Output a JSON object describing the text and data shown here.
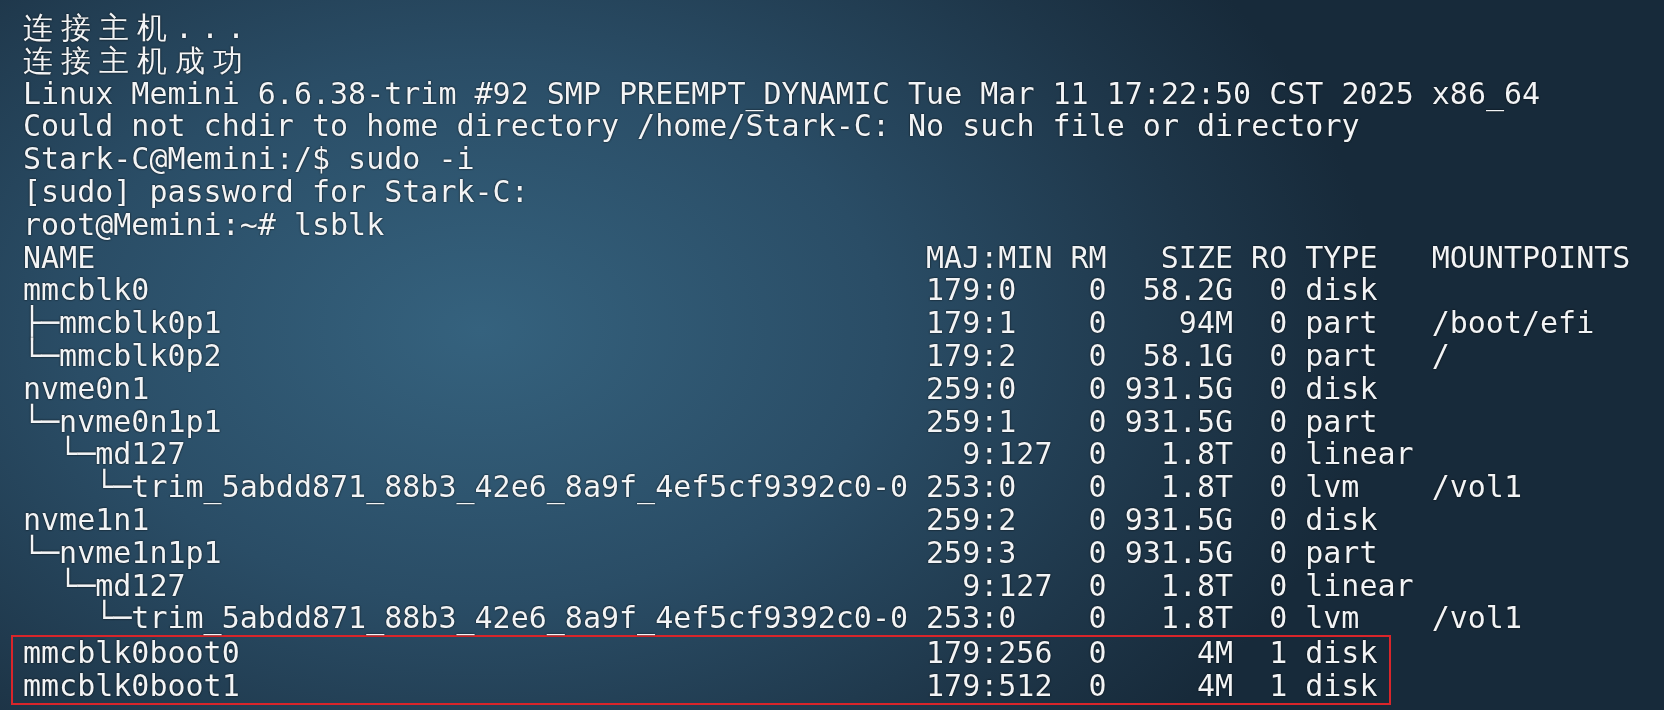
{
  "terminal": {
    "lines": [
      "连接主机...",
      "连接主机成功",
      "Linux Memini 6.6.38-trim #92 SMP PREEMPT_DYNAMIC Tue Mar 11 17:22:50 CST 2025 x86_64",
      "Could not chdir to home directory /home/Stark-C: No such file or directory",
      "Stark-C@Memini:/$ sudo -i",
      "[sudo] password for Stark-C:",
      "root@Memini:~# lsblk"
    ]
  },
  "lsblk": {
    "columns": [
      "NAME",
      "MAJ:MIN",
      "RM",
      "SIZE",
      "RO",
      "TYPE",
      "MOUNTPOINTS"
    ],
    "rows": [
      {
        "name": "mmcblk0",
        "maj_min": "179:0",
        "rm": "0",
        "size": "58.2G",
        "ro": "0",
        "type": "disk",
        "highlighted": false,
        "children": [
          {
            "name": "├─mmcblk0p1",
            "maj_min": "179:1",
            "rm": "0",
            "size": "94M",
            "ro": "0",
            "type": "part",
            "mountpoints": "/boot/efi"
          },
          {
            "name": "└─mmcblk0p2",
            "maj_min": "179:2",
            "rm": "0",
            "size": "58.1G",
            "ro": "0",
            "type": "part",
            "mountpoints": "/"
          }
        ]
      },
      {
        "name": "nvme0n1",
        "maj_min": "259:0",
        "rm": "0",
        "size": "931.5G",
        "ro": "0",
        "type": "disk",
        "highlighted": false,
        "children": [
          {
            "name": "└─nvme0n1p1",
            "maj_min": "259:1",
            "rm": "0",
            "size": "931.5G",
            "ro": "0",
            "type": "part",
            "children": [
              {
                "name": "└─md127",
                "maj_min": "  9:127",
                "rm": "0",
                "size": "1.8T",
                "ro": "0",
                "type": "linear",
                "children": [
                  {
                    "name": "└─trim_5abdd871_88b3_42e6_8a9f_4ef5cf9392c0-0",
                    "maj_min": "253:0",
                    "rm": "0",
                    "size": "1.8T",
                    "ro": "0",
                    "type": "lvm",
                    "mountpoints": "/vol1"
                  }
                ]
              }
            ]
          }
        ]
      },
      {
        "name": "nvme1n1",
        "maj_min": "259:2",
        "rm": "0",
        "size": "931.5G",
        "ro": "0",
        "type": "disk",
        "highlighted": false,
        "children": [
          {
            "name": "└─nvme1n1p1",
            "maj_min": "259:3",
            "rm": "0",
            "size": "931.5G",
            "ro": "0",
            "type": "part",
            "children": [
              {
                "name": "└─md127",
                "maj_min": "  9:127",
                "rm": "0",
                "size": "1.8T",
                "ro": "0",
                "type": "linear",
                "children": [
                  {
                    "name": "└─trim_5abdd871_88b3_42e6_8a9f_4ef5cf9392c0-0",
                    "maj_min": "253:0",
                    "rm": "0",
                    "size": "1.8T",
                    "ro": "0",
                    "type": "lvm",
                    "mountpoints": "/vol1"
                  }
                ]
              }
            ]
          }
        ]
      },
      {
        "name": "mmcblk0boot0",
        "maj_min": "179:256",
        "rm": "0",
        "size": "4M",
        "ro": "1",
        "type": "disk",
        "highlighted": true
      },
      {
        "name": "mmcblk0boot1",
        "maj_min": "179:512",
        "rm": "0",
        "size": "4M",
        "ro": "1",
        "type": "disk",
        "highlighted": true
      }
    ]
  }
}
